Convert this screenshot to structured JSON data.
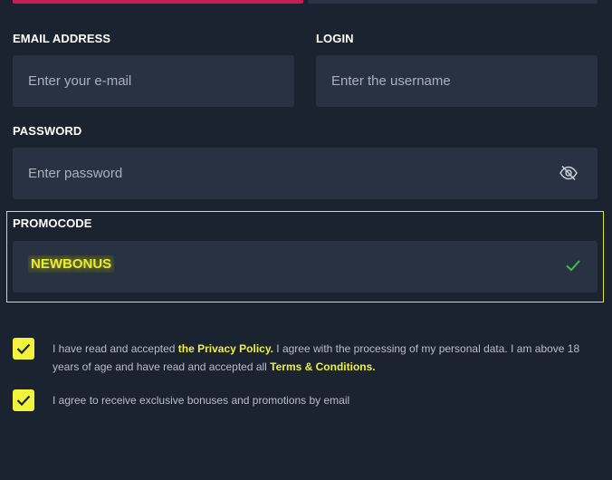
{
  "tabs": {
    "active_color": "#c41e54",
    "inactive_color": "#2a3243"
  },
  "form": {
    "email": {
      "label": "EMAIL ADDRESS",
      "placeholder": "Enter your e-mail",
      "value": ""
    },
    "login": {
      "label": "LOGIN",
      "placeholder": "Enter the username",
      "value": ""
    },
    "password": {
      "label": "PASSWORD",
      "placeholder": "Enter password",
      "value": "",
      "toggle_icon": "eye-slash-icon"
    },
    "promocode": {
      "label": "PROMOCODE",
      "value": "NEWBONUS",
      "status_icon": "check-icon",
      "highlight_color": "#e3e62a"
    }
  },
  "consents": [
    {
      "checked": true,
      "text_1": "I have read and accepted ",
      "link_1": "the Privacy Policy.",
      "text_2": " I agree with the processing of my personal data. I am above 18 years of age and have read and accepted all ",
      "link_2": "Terms & Conditions."
    },
    {
      "checked": true,
      "text": "I agree to receive exclusive bonuses and promotions by email"
    }
  ],
  "colors": {
    "background": "#1b2230",
    "field": "#283243",
    "accent_yellow": "#f1f43a",
    "success_green": "#3fbf4a"
  }
}
